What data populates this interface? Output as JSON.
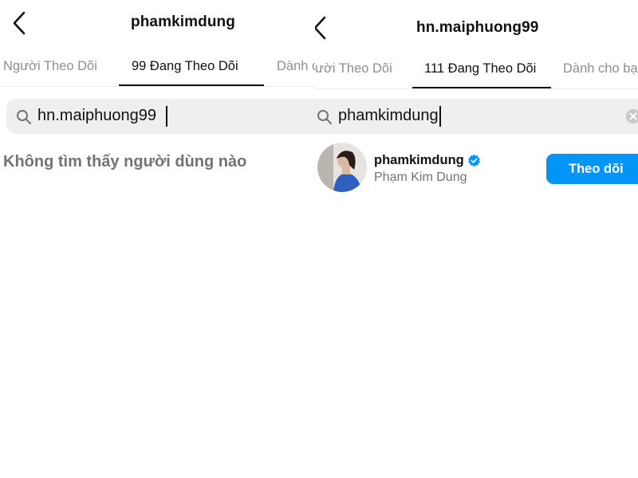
{
  "colors": {
    "accent": "#0095f6",
    "text_primary": "#111111",
    "text_secondary": "#737373",
    "search_bg": "#efefef",
    "verified": "#0095f6"
  },
  "left": {
    "back_icon": "chevron-left-icon",
    "title": "phamkimdung",
    "tabs": [
      {
        "label": "Người Theo Dõi",
        "active": false
      },
      {
        "label": "99 Đang Theo Dõi",
        "active": true
      },
      {
        "label": "Dành c",
        "active": false
      }
    ],
    "search": {
      "icon": "search-icon",
      "value": "hn.maiphuong99"
    },
    "empty_message": "Không tìm thấy người dùng nào"
  },
  "right": {
    "back_icon": "chevron-left-icon",
    "title": "hn.maiphuong99",
    "tabs": [
      {
        "label": "ười Theo Dõi",
        "active": false
      },
      {
        "label": "111 Đang Theo Dõi",
        "active": true
      },
      {
        "label": "Dành cho bạ",
        "active": false
      }
    ],
    "search": {
      "icon": "search-icon",
      "value": "phamkimdung",
      "clear_icon": "clear-icon"
    },
    "results": [
      {
        "username": "phamkimdung",
        "verified": true,
        "full_name": "Phạm Kim Dung",
        "button": "Theo dõi"
      }
    ]
  }
}
